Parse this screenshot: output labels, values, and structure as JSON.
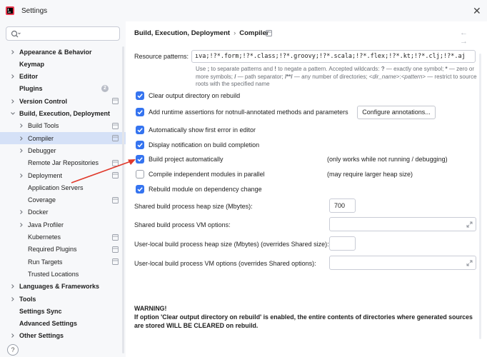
{
  "window": {
    "title": "Settings",
    "close_icon": "close-icon",
    "app_icon": "intellij-app-icon"
  },
  "sidebar": {
    "search_placeholder": "",
    "items": [
      {
        "label": "Appearance & Behavior",
        "bold": true,
        "expandable": true,
        "expanded": false,
        "level": 0
      },
      {
        "label": "Keymap",
        "bold": true,
        "expandable": false,
        "level": 0
      },
      {
        "label": "Editor",
        "bold": true,
        "expandable": true,
        "expanded": false,
        "level": 0
      },
      {
        "label": "Plugins",
        "bold": true,
        "expandable": false,
        "level": 0,
        "badge": "2"
      },
      {
        "label": "Version Control",
        "bold": true,
        "expandable": true,
        "expanded": false,
        "level": 0,
        "project_icon": true
      },
      {
        "label": "Build, Execution, Deployment",
        "bold": true,
        "expandable": true,
        "expanded": true,
        "level": 0
      },
      {
        "label": "Build Tools",
        "bold": false,
        "expandable": true,
        "expanded": false,
        "level": 1,
        "project_icon": true
      },
      {
        "label": "Compiler",
        "bold": false,
        "expandable": true,
        "expanded": false,
        "level": 1,
        "project_icon": true,
        "selected": true
      },
      {
        "label": "Debugger",
        "bold": false,
        "expandable": true,
        "expanded": false,
        "level": 1
      },
      {
        "label": "Remote Jar Repositories",
        "bold": false,
        "expandable": false,
        "level": 1,
        "project_icon": true
      },
      {
        "label": "Deployment",
        "bold": false,
        "expandable": true,
        "expanded": false,
        "level": 1,
        "project_icon": true
      },
      {
        "label": "Application Servers",
        "bold": false,
        "expandable": false,
        "level": 1
      },
      {
        "label": "Coverage",
        "bold": false,
        "expandable": false,
        "level": 1,
        "project_icon": true
      },
      {
        "label": "Docker",
        "bold": false,
        "expandable": true,
        "expanded": false,
        "level": 1
      },
      {
        "label": "Java Profiler",
        "bold": false,
        "expandable": true,
        "expanded": false,
        "level": 1
      },
      {
        "label": "Kubernetes",
        "bold": false,
        "expandable": false,
        "level": 1,
        "project_icon": true
      },
      {
        "label": "Required Plugins",
        "bold": false,
        "expandable": false,
        "level": 1,
        "project_icon": true
      },
      {
        "label": "Run Targets",
        "bold": false,
        "expandable": false,
        "level": 1,
        "project_icon": true
      },
      {
        "label": "Trusted Locations",
        "bold": false,
        "expandable": false,
        "level": 1
      },
      {
        "label": "Languages & Frameworks",
        "bold": true,
        "expandable": true,
        "expanded": false,
        "level": 0
      },
      {
        "label": "Tools",
        "bold": true,
        "expandable": true,
        "expanded": false,
        "level": 0
      },
      {
        "label": "Settings Sync",
        "bold": true,
        "expandable": false,
        "level": 0
      },
      {
        "label": "Advanced Settings",
        "bold": true,
        "expandable": false,
        "level": 0
      },
      {
        "label": "Other Settings",
        "bold": true,
        "expandable": true,
        "expanded": false,
        "level": 0
      }
    ],
    "help_label": "?"
  },
  "main": {
    "breadcrumb": {
      "parent": "Build, Execution, Deployment",
      "separator": "›",
      "current": "Compiler"
    },
    "nav_arrows": "← →",
    "resource_patterns": {
      "label": "Resource patterns:",
      "value": "ıva;!?*.form;!?*.class;!?*.groovy;!?*.scala;!?*.flex;!?*.kt;!?*.clj;!?*.aj",
      "help_parts": [
        "Use ",
        ";",
        " to separate patterns and ",
        "!",
        " to negate a pattern. Accepted wildcards: ",
        "?",
        " — exactly one symbol; ",
        "*",
        " — zero or more symbols; ",
        "/",
        " — path separator; ",
        "/**/",
        " — any number of directories; ",
        "<dir_name>",
        ":",
        "<pattern>",
        " — restrict to source roots with the specified name"
      ]
    },
    "checkboxes": [
      {
        "label": "Clear output directory on rebuild",
        "checked": true
      },
      {
        "label": "Add runtime assertions for notnull-annotated methods and parameters",
        "checked": true
      },
      {
        "label": "Automatically show first error in editor",
        "checked": true
      },
      {
        "label": "Display notification on build completion",
        "checked": true
      },
      {
        "label": "Build project automatically",
        "checked": true
      },
      {
        "label": "Compile independent modules in parallel",
        "checked": false
      },
      {
        "label": "Rebuild module on dependency change",
        "checked": true
      }
    ],
    "configure_annotations_label": "Configure annotations...",
    "notes": {
      "build_automatically": "(only works while not running / debugging)",
      "parallel": "(may require larger heap size)"
    },
    "fields": {
      "shared_heap_label": "Shared build process heap size (Mbytes):",
      "shared_heap_value": "700",
      "shared_vm_label": "Shared build process VM options:",
      "shared_vm_value": "",
      "user_heap_label": "User-local build process heap size (Mbytes) (overrides Shared size):",
      "user_heap_value": "",
      "user_vm_label": "User-local build process VM options (overrides Shared options):",
      "user_vm_value": ""
    },
    "warning": {
      "title": "WARNING!",
      "body": "If option 'Clear output directory on rebuild' is enabled, the entire contents of directories where generated sources are stored WILL BE CLEARED on rebuild."
    }
  },
  "annotation": {
    "arrow_color": "#e0392b"
  },
  "colors": {
    "accent": "#3574f0",
    "selection": "#d5e1f7",
    "sidebar_bg": "#f7f8fa"
  }
}
